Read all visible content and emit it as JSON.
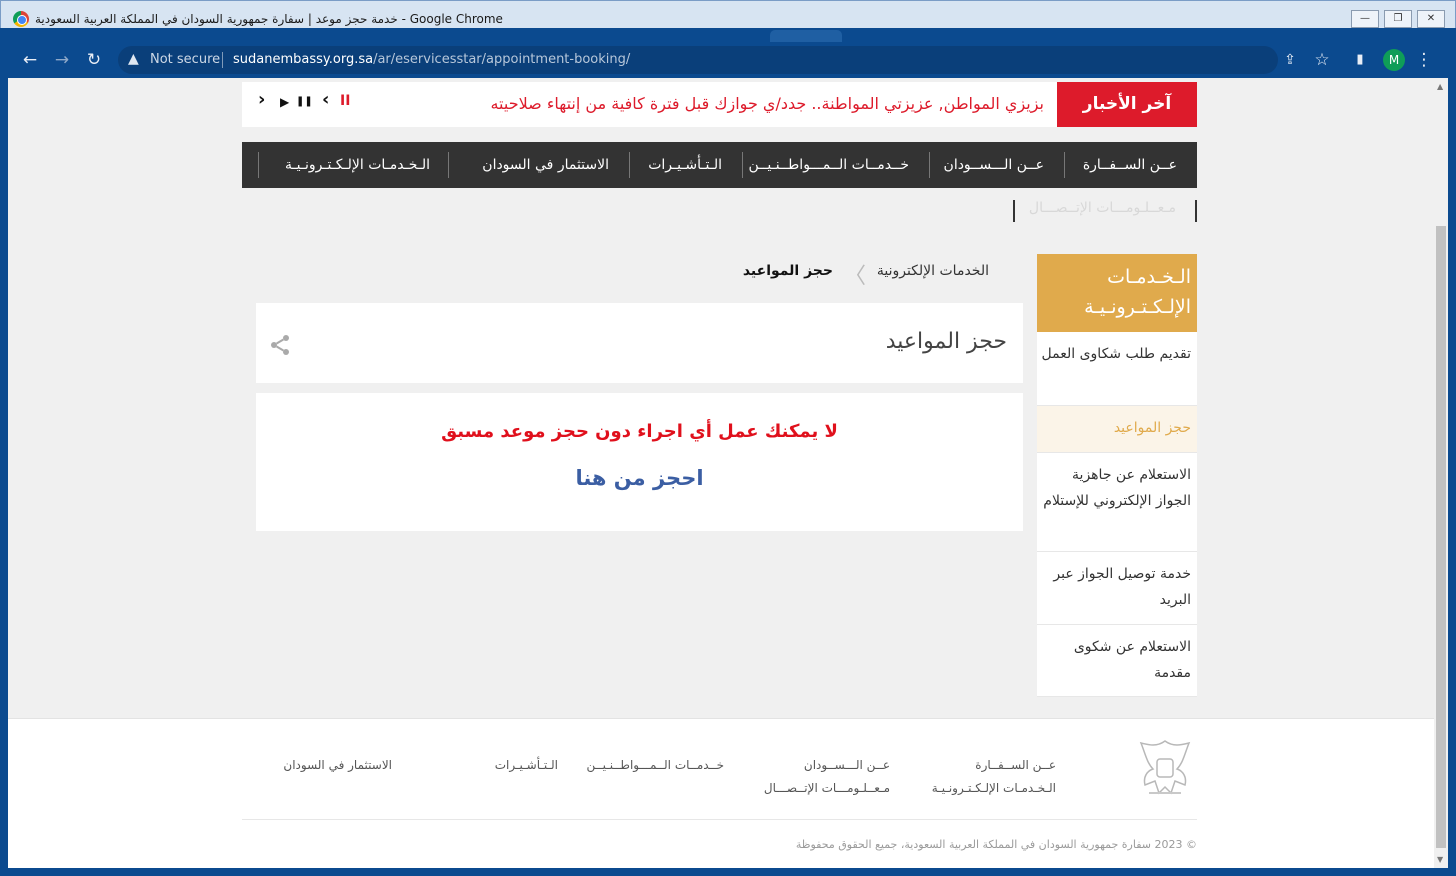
{
  "window": {
    "title": "خدمة حجز موعد | سفارة جمهورية السودان في المملكة العربية السعودية - Google Chrome",
    "minimize": "—",
    "restore": "❐",
    "close": "✕"
  },
  "toolbar": {
    "back_icon": "←",
    "forward_icon": "→",
    "reload_icon": "↻",
    "security_icon": "▲",
    "security_label": "Not secure",
    "url_domain": "sudanembassy.org.sa",
    "url_path": "/ar/eservicesstar/appointment-booking/",
    "share_icon": "⇪",
    "bookmark_icon": "☆",
    "sidepanel_icon": "▮",
    "profile_initial": "M",
    "menu_icon": "⋮"
  },
  "news": {
    "label": "آخر الأخبار",
    "ticker": "بزيزي المواطن, عزيزتي المواطنة.. جدد/ي جوازك قبل فترة كافية من إنتهاء صلاحيته",
    "pause_mark": "II",
    "prev": "‹",
    "play": "▶",
    "pause": "❚❚",
    "next": "›"
  },
  "nav": {
    "items": [
      "عــن الســفــارة",
      "عــن الـــســودان",
      "خــدمــات الــمـــواطــنـيــن",
      "الـتـأشـيـرات",
      "الاستثمار في السودان",
      "الـخـدمـات الإلـكـتـرونـيـة"
    ],
    "contact": "مـعــلـومـــات الإتــصـــال"
  },
  "breadcrumb": {
    "parent": "الخدمات الإلكترونية",
    "separator": "〈",
    "current": "حجز المواعيد"
  },
  "page": {
    "heading": "حجز المواعيد",
    "share_icon": "share-icon",
    "warning": "لا يمكنك عمل أي اجراء دون حجز موعد مسبق",
    "book_link": "احجز من هنا"
  },
  "sidebar": {
    "title": "الـخـدمـات الإلـكـتـرونـيـة",
    "items": [
      "تقديم طلب شكاوى العمل",
      "حجز المواعيد",
      "الاستعلام عن جاهزية الجواز الإلكتروني للإستلام",
      "خدمة توصيل الجواز عبر البريد",
      "الاستعلام عن شكوى مقدمة"
    ]
  },
  "footer": {
    "links": [
      "عــن الســفــارة",
      "الـخـدمـات الإلـكـتـرونـيـة",
      "عــن الـــســودان",
      "مـعــلـومـــات الإتــصـــال",
      "خــدمــات الــمـــواطــنـيــن",
      "الـتـأشـيـرات",
      "الاستثمار في السودان"
    ],
    "copyright": "© 2023 سفارة جمهورية السودان في المملكة العربية السعودية، جميع الحقوق محفوظة"
  },
  "colors": {
    "news_red": "#dd1b2b",
    "sidebar_gold": "#e0aa4c",
    "nav_dark": "#333333",
    "link_blue": "#3b5ea3",
    "chrome_blue": "#0b4a8f"
  }
}
